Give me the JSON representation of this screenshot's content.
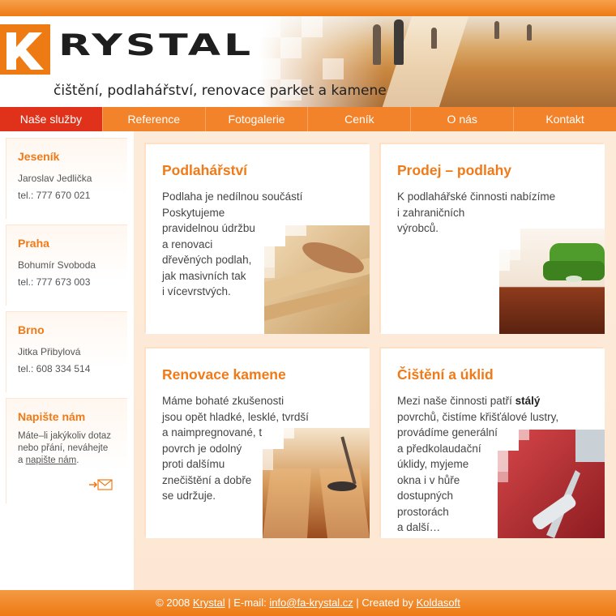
{
  "header": {
    "logo_text": "RYSTAL",
    "logo_initial": "K",
    "tagline": "čištění, podlahářství, renovace parket a kamene"
  },
  "nav": {
    "items": [
      {
        "label": "Naše služby",
        "active": true
      },
      {
        "label": "Reference"
      },
      {
        "label": "Fotogalerie"
      },
      {
        "label": "Ceník"
      },
      {
        "label": "O nás"
      },
      {
        "label": "Kontakt"
      }
    ]
  },
  "sidebar": {
    "contacts": [
      {
        "city": "Jeseník",
        "name": "Jaroslav Jedlička",
        "phone": "tel.: 777 670 021"
      },
      {
        "city": "Praha",
        "name": "Bohumír Svoboda",
        "phone": "tel.: 777 673 003"
      },
      {
        "city": "Brno",
        "name": "Jitka Přibylová",
        "phone": "tel.: 608 334 514"
      }
    ],
    "write_us": {
      "title": "Napište nám",
      "text_line1": "Máte–li jakýkoliv dotaz",
      "text_line2": "nebo přání, neváhejte",
      "text_prefix": "a ",
      "link": "napište nám",
      "text_suffix": "."
    }
  },
  "services": [
    {
      "title": "Podlahářství",
      "lines": [
        "Podlaha je nedílnou součástí",
        "Poskytujeme",
        "pravidelnou údržbu",
        "a renovaci",
        "dřevěných podlah,",
        "jak masivních tak",
        "i vícevrstvých."
      ]
    },
    {
      "title": "Prodej – podlahy",
      "lines": [
        "K podlahářské činnosti nabízíme",
        "i zahraničních",
        "výrobců."
      ]
    },
    {
      "title": "Renovace kamene",
      "lines": [
        "Máme bohaté zkušenosti",
        "jsou opět hladké, lesklé, tvrdší",
        "a naimpregnované, tudíž jejich",
        "povrch je odolný",
        "proti dalšímu",
        "znečištění a dobře",
        "se udržuje."
      ]
    },
    {
      "title": "Čištění a úklid",
      "line1_prefix": "Mezi naše činnosti patří ",
      "line1_bold": "stálý",
      "lines": [
        "povrchů, čistíme křišťálové lustry,",
        "provádíme generální",
        "a předkolaudační",
        "úklidy, myjeme",
        "okna i v hůře",
        "dostupných",
        "prostorách",
        "a další…"
      ]
    }
  ],
  "footer": {
    "copyright": "© 2008 ",
    "brand_link": "Krystal",
    "email_label": " | E-mail: ",
    "email": "info@fa-krystal.cz",
    "created_label": " | Created by ",
    "creator_link": "Koldasoft"
  },
  "colors": {
    "accent": "#ee7a14",
    "active_nav": "#e0321a",
    "heading": "#f07a17"
  },
  "icons": {
    "mail": "envelope-arrow-icon",
    "logo": "krystal-logo"
  }
}
